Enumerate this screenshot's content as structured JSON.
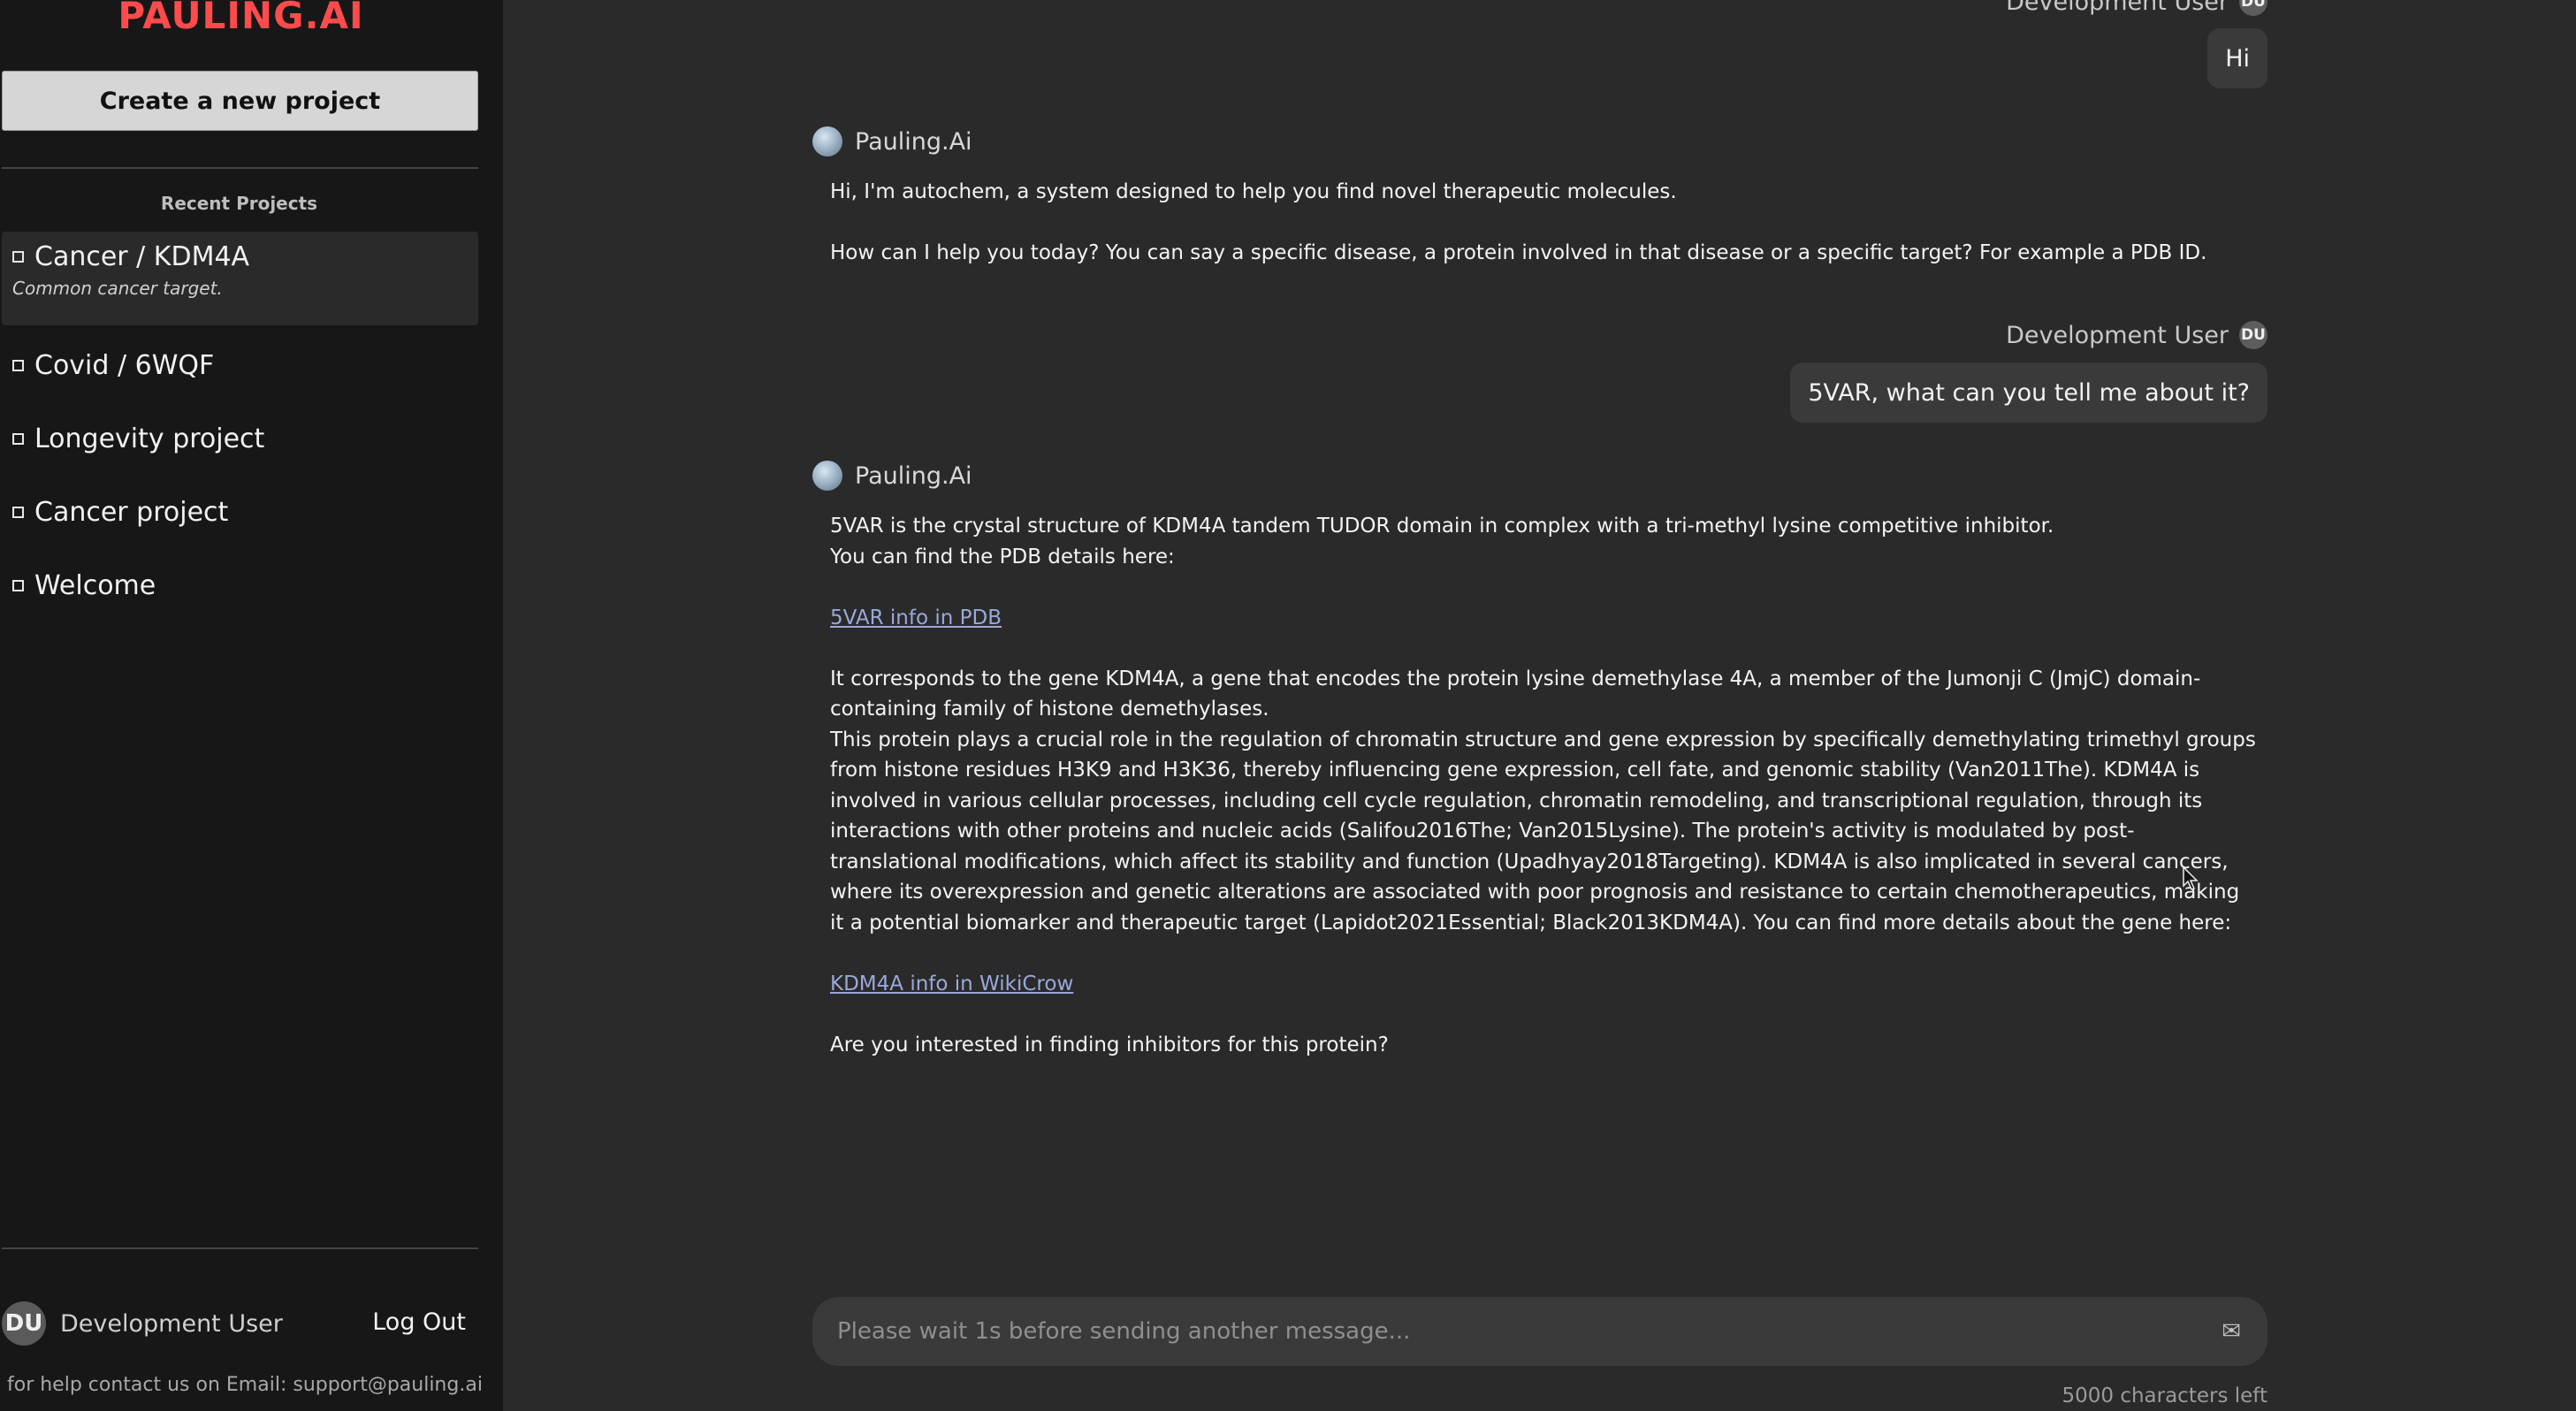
{
  "sidebar": {
    "logo": "PAULING.AI",
    "new_project_label": "Create a new project",
    "recent_title": "Recent Projects",
    "projects": [
      {
        "label": "Cancer / KDM4A",
        "description": "Common cancer target."
      },
      {
        "label": "Covid / 6WQF"
      },
      {
        "label": "Longevity project"
      },
      {
        "label": "Cancer project"
      },
      {
        "label": "Welcome"
      }
    ],
    "footer": {
      "avatar_initials": "DU",
      "username": "Development User",
      "logout_label": "Log Out",
      "help_text": "for help contact us on Email: support@pauling.ai"
    }
  },
  "chat": {
    "messages": [
      {
        "role": "user",
        "author": "Development User",
        "initials": "DU",
        "text": "Hi"
      },
      {
        "role": "bot",
        "author": "Pauling.Ai",
        "lines": [
          "Hi, I'm autochem, a system designed to help you find novel therapeutic molecules.",
          "How can I help you today? You can say a specific disease, a protein involved in that disease or a specific target? For example a PDB ID."
        ]
      },
      {
        "role": "user",
        "author": "Development User",
        "initials": "DU",
        "text": "5VAR, what can you tell me about it?"
      },
      {
        "role": "bot",
        "author": "Pauling.Ai",
        "p1": "5VAR is the crystal structure of KDM4A tandem TUDOR domain in complex with a tri-methyl lysine competitive inhibitor.",
        "p2": "You can find the PDB details here:",
        "link1": "5VAR info in PDB",
        "p3": "It corresponds to the gene KDM4A, a gene that encodes the protein lysine demethylase 4A, a member of the Jumonji C (JmjC) domain-containing family of histone demethylases.",
        "p4": "This protein plays a crucial role in the regulation of chromatin structure and gene expression by specifically demethylating trimethyl groups from histone residues H3K9 and H3K36, thereby influencing gene expression, cell fate, and genomic stability (Van2011The). KDM4A is involved in various cellular processes, including cell cycle regulation, chromatin remodeling, and transcriptional regulation, through its interactions with other proteins and nucleic acids (Salifou2016The; Van2015Lysine). The protein's activity is modulated by post-translational modifications, which affect its stability and function (Upadhyay2018Targeting). KDM4A is also implicated in several cancers, where its overexpression and genetic alterations are associated with poor prognosis and resistance to certain chemotherapeutics, making it a potential biomarker and therapeutic target (Lapidot2021Essential; Black2013KDM4A). You can find more details about the gene here:",
        "link2": "KDM4A info in WikiCrow",
        "p5": "Are you interested in finding inhibitors for this protein?"
      }
    ],
    "input": {
      "placeholder": "Please wait 1s before sending another message...",
      "value": "",
      "send_icon": "envelope-icon"
    },
    "chars_left": "5000 characters left"
  }
}
